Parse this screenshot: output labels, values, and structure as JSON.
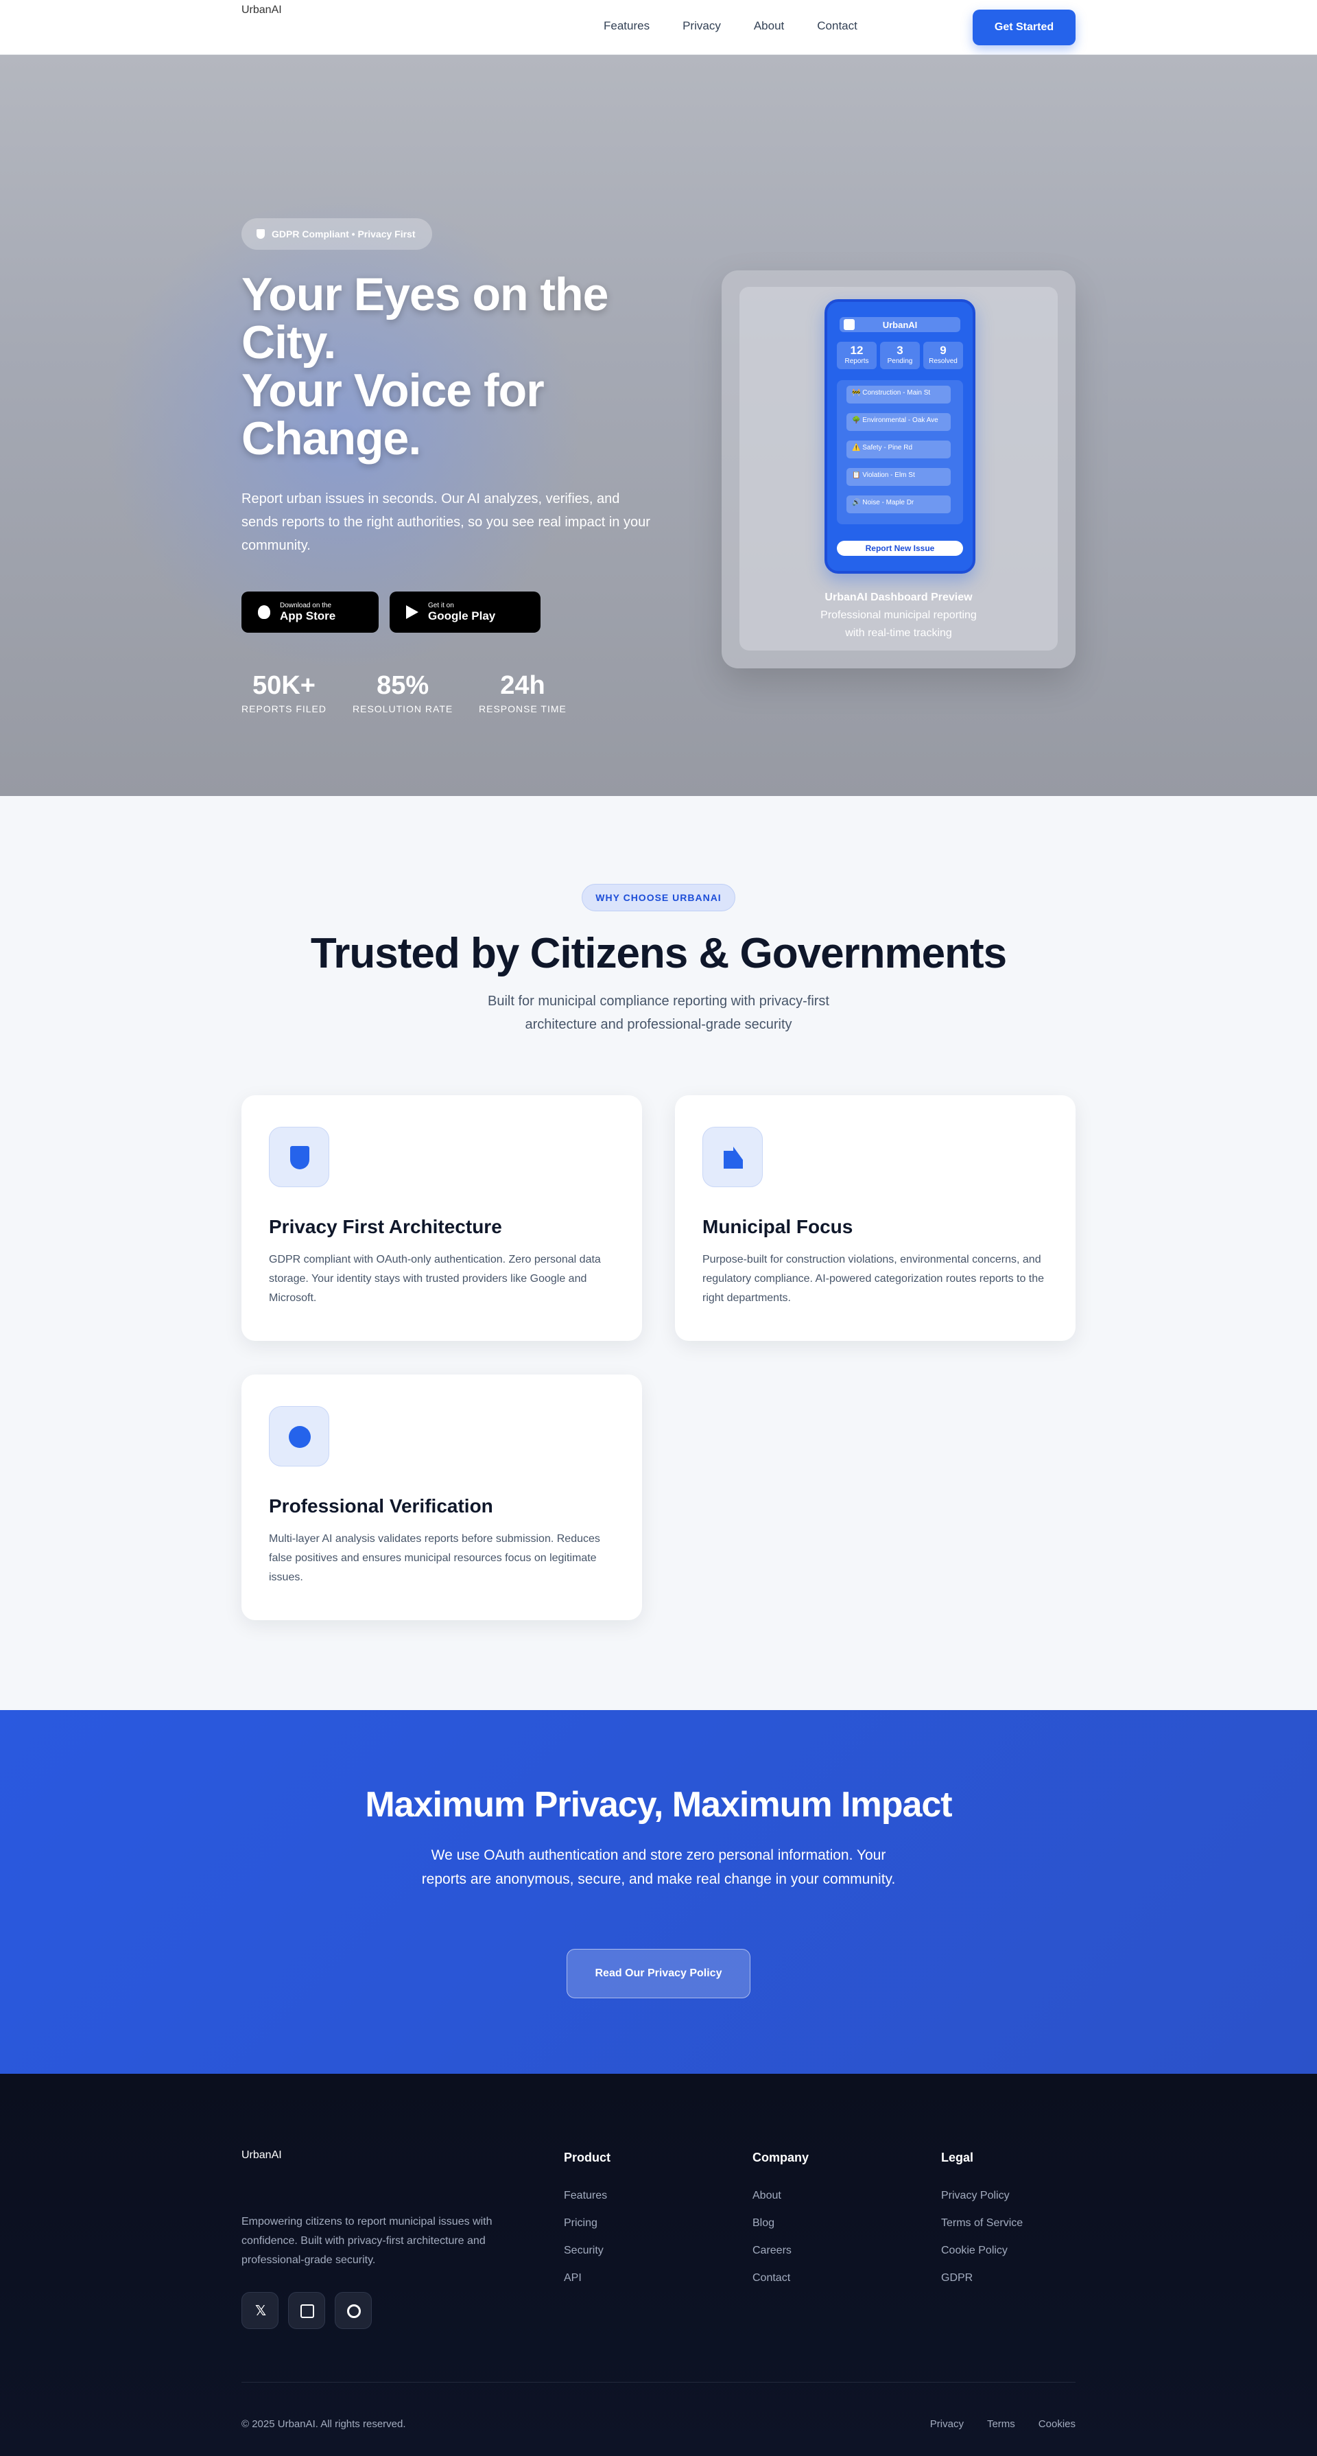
{
  "nav": {
    "logo_alt": "UrbanAI",
    "links": [
      "Features",
      "Privacy",
      "About",
      "Contact"
    ],
    "cta": "Get Started"
  },
  "hero": {
    "badge": "GDPR Compliant • Privacy First",
    "title_line1": "Your Eyes on the City.",
    "title_line2": "Your Voice for Change.",
    "subtitle": "Report urban issues in seconds. Our AI analyzes, verifies, and sends reports to the right authorities, so you see real impact in your community.",
    "app_store": {
      "small": "Download on the",
      "big": "App Store"
    },
    "google_play": {
      "small": "Get it on",
      "big": "Google Play"
    },
    "stats": [
      {
        "num": "50K+",
        "label": "REPORTS FILED"
      },
      {
        "num": "85%",
        "label": "RESOLUTION RATE"
      },
      {
        "num": "24h",
        "label": "RESPONSE TIME"
      }
    ],
    "mock": {
      "app_name": "UrbanAI",
      "stats": [
        {
          "n": "12",
          "l": "Reports"
        },
        {
          "n": "3",
          "l": "Pending"
        },
        {
          "n": "9",
          "l": "Resolved"
        }
      ],
      "items": [
        "🚧 Construction - Main St",
        "🌳 Environmental - Oak Ave",
        "⚠️ Safety - Pine Rd",
        "📋 Violation - Elm St",
        "🔊 Noise - Maple Dr"
      ],
      "button": "Report New Issue",
      "caption_title": "UrbanAI Dashboard Preview",
      "caption_sub": "Professional municipal reporting with real-time tracking"
    }
  },
  "features": {
    "pill": "WHY CHOOSE URBANAI",
    "title": "Trusted by Citizens & Governments",
    "subtitle": "Built for municipal compliance reporting with privacy-first architecture and professional-grade security",
    "cards": [
      {
        "icon": "shield-icon",
        "title": "Privacy First Architecture",
        "text": "GDPR compliant with OAuth-only authentication. Zero personal data storage. Your identity stays with trusted providers like Google and Microsoft."
      },
      {
        "icon": "building-icon",
        "title": "Municipal Focus",
        "text": "Purpose-built for construction violations, environmental concerns, and regulatory compliance. AI-powered categorization routes reports to the right departments."
      },
      {
        "icon": "circle-check-icon",
        "title": "Professional Verification",
        "text": "Multi-layer AI analysis validates reports before submission. Reduces false positives and ensures municipal resources focus on legitimate issues."
      }
    ]
  },
  "privacy": {
    "title": "Maximum Privacy, Maximum Impact",
    "text": "We use OAuth authentication and store zero personal information. Your reports are anonymous, secure, and make real change in your community.",
    "button": "Read Our Privacy Policy"
  },
  "footer": {
    "logo_alt": "UrbanAI",
    "description": "Empowering citizens to report municipal issues with confidence. Built with privacy-first architecture and professional-grade security.",
    "social": [
      "x-icon",
      "linkedin-icon",
      "github-icon"
    ],
    "columns": [
      {
        "heading": "Product",
        "links": [
          "Features",
          "Pricing",
          "Security",
          "API"
        ]
      },
      {
        "heading": "Company",
        "links": [
          "About",
          "Blog",
          "Careers",
          "Contact"
        ]
      },
      {
        "heading": "Legal",
        "links": [
          "Privacy Policy",
          "Terms of Service",
          "Cookie Policy",
          "GDPR"
        ]
      }
    ],
    "copyright": "© 2025 UrbanAI. All rights reserved.",
    "bottom_links": [
      "Privacy",
      "Terms",
      "Cookies"
    ]
  },
  "colors": {
    "accent": "#2563eb",
    "footer_bg": "#0b0f1e",
    "privacy_bg": "#2a59df"
  }
}
